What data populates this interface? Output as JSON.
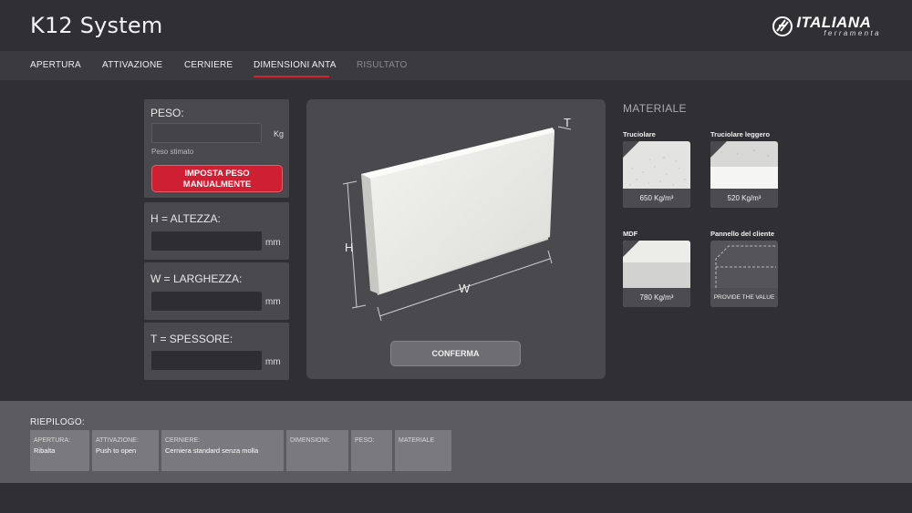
{
  "app": {
    "title": "K12 System",
    "brand": "ITALIANA",
    "brand_sub": "ferramenta",
    "accent_color": "#d3202f"
  },
  "nav": {
    "items": [
      {
        "label": "APERTURA"
      },
      {
        "label": "ATTIVAZIONE"
      },
      {
        "label": "CERNIERE"
      },
      {
        "label": "DIMENSIONI ANTA",
        "active": true
      },
      {
        "label": "RISULTATO",
        "disabled": true
      }
    ]
  },
  "peso": {
    "label": "PESO:",
    "value": "",
    "unit": "Kg",
    "note": "Peso stimato",
    "button_line1": "IMPOSTA PESO",
    "button_line2": "MANUALMENTE"
  },
  "altezza": {
    "letter": "H",
    "label": " = ALTEZZA:",
    "value": "",
    "unit": "mm"
  },
  "larghezza": {
    "letter": "W",
    "label": " = LARGHEZZA:",
    "value": "",
    "unit": "mm"
  },
  "spessore": {
    "letter": "T",
    "label": " = SPESSORE:",
    "value": "",
    "unit": "mm"
  },
  "diagram": {
    "h": "H",
    "w": "W",
    "t": "T"
  },
  "confirm_label": "CONFERMA",
  "materiale": {
    "title": "MATERIALE",
    "options": [
      {
        "name": "Truciolare",
        "value": "650 Kg/m³"
      },
      {
        "name": "Truciolare leggero",
        "value": "520 Kg/m³"
      },
      {
        "name": "MDF",
        "value": "780 Kg/m³"
      },
      {
        "name": "Pannello del cliente",
        "value": "PROVIDE THE VALUE"
      }
    ]
  },
  "riepilogo": {
    "title": "RIEPILOGO:",
    "items": [
      {
        "label": "APERTURA:",
        "value": "Ribalta"
      },
      {
        "label": "ATTIVAZIONE:",
        "value": "Push to open"
      },
      {
        "label": "CERNIERE:",
        "value": "Cerniera standard senza molla"
      },
      {
        "label": "DIMENSIONI:",
        "value": ""
      },
      {
        "label": "PESO:",
        "value": ""
      },
      {
        "label": "MATERIALE",
        "value": ""
      }
    ]
  }
}
